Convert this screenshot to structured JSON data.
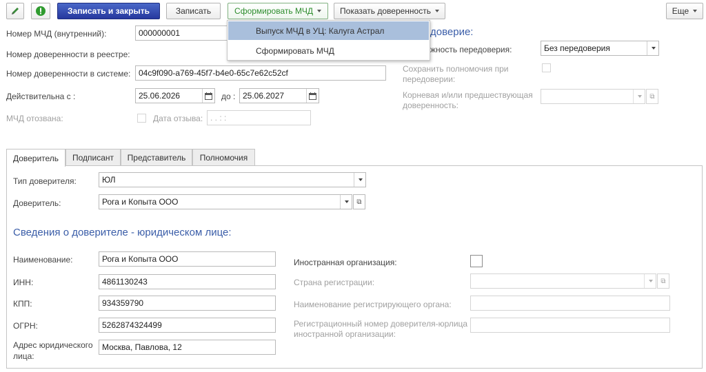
{
  "toolbar": {
    "save_close": "Записать и закрыть",
    "save": "Записать",
    "form_mchd": "Сформировать МЧД",
    "show_poa": "Показать доверенность",
    "more": "Еще"
  },
  "dropdown_menu": {
    "items": [
      "Выпуск МЧД в УЦ: Калуга Астрал",
      "Сформировать МЧД"
    ]
  },
  "header": {
    "mchd_internal_label": "Номер МЧД (внутренний):",
    "mchd_internal_value": "000000001",
    "registry_label": "Номер доверенности в реестре:",
    "system_label": "Номер доверенности в системе:",
    "system_value": "04c9f090-a769-45f7-b4e0-65c7e62c52cf",
    "valid_from_label": "Действительна с :",
    "valid_from_value": "25.06.2026",
    "valid_to_label": "до :",
    "valid_to_value": "25.06.2027",
    "revoked_label": "МЧД отозвана:",
    "revoke_date_label": "Дата отзыва:",
    "revoke_date_placeholder": " .  .       :  :"
  },
  "redelegation": {
    "title_fragment": "доверие:",
    "possibility_label": "жность передоверия:",
    "possibility_value": "Без передоверия",
    "keep_powers_label": [
      "Сохранить полномочия при",
      "передоверии:"
    ],
    "root_poa_label": [
      "Корневая и/или предшествующая",
      "доверенность:"
    ]
  },
  "tabs": [
    "Доверитель",
    "Подписант",
    "Представитель",
    "Полномочия"
  ],
  "principal": {
    "type_label": "Тип доверителя:",
    "type_value": "ЮЛ",
    "principal_label": "Доверитель:",
    "principal_value": "Рога и Копыта ООО",
    "section_title": "Сведения о доверителе - юридическом лице:",
    "name_label": "Наименование:",
    "name_value": "Рога и Копыта ООО",
    "inn_label": "ИНН:",
    "inn_value": "4861130243",
    "kpp_label": "КПП:",
    "kpp_value": "934359790",
    "ogrn_label": "ОГРН:",
    "ogrn_value": "5262874324499",
    "address_label": [
      "Адрес юридического",
      "лица:"
    ],
    "address_value": "Москва, Павлова, 12",
    "foreign_org_label": "Иностранная организация:",
    "reg_country_label": "Страна регистрации:",
    "reg_authority_label": "Наименование регистрирующего органа:",
    "reg_number_label": [
      "Регистрационный номер доверителя-юрлица",
      "иностранной организации:"
    ]
  },
  "colors": {
    "accent": "#3a5da8",
    "primary_button": "#26389e",
    "menu_highlight": "#a9bfdc",
    "green": "#2c8c2c"
  },
  "icons": [
    "pen-icon",
    "exclamation-icon",
    "calendar-icon",
    "chevron-down-icon",
    "open-link-icon"
  ]
}
